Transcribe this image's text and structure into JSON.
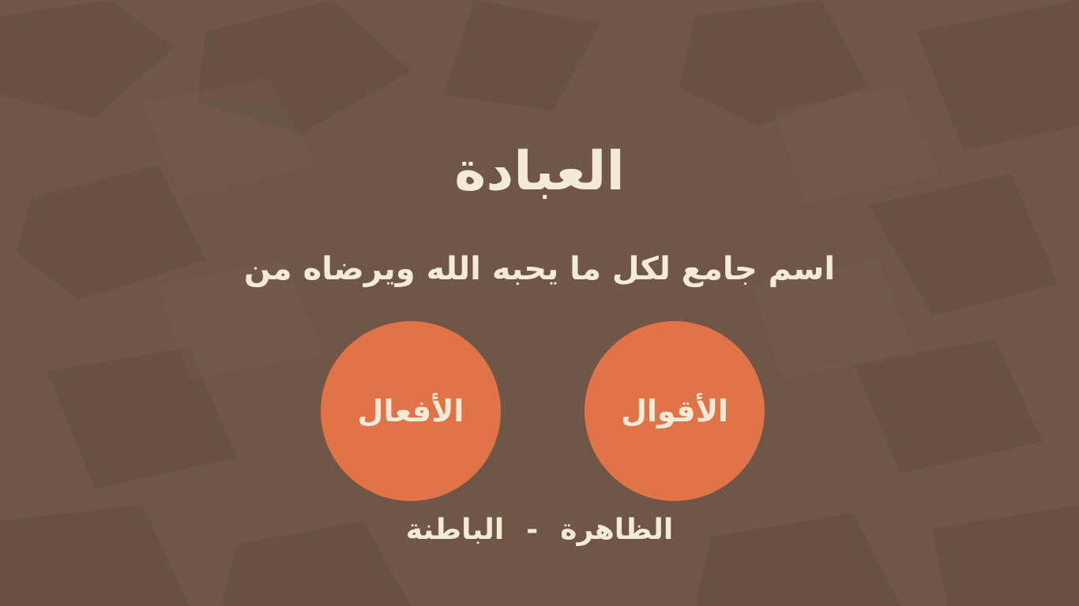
{
  "slide": {
    "title": "العبادة",
    "subtitle": "اسم جامع لكل ما يحبه الله ويرضاه من",
    "circles": [
      {
        "label": "الأقوال"
      },
      {
        "label": "الأفعال"
      }
    ],
    "bottom": {
      "left_word": "الظاهرة",
      "separator": "-",
      "right_word": "الباطنة"
    }
  },
  "colors": {
    "background": "#6f5646",
    "text": "#f4ead8",
    "circle_fill": "#e07448"
  }
}
